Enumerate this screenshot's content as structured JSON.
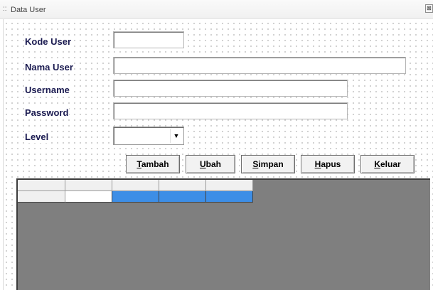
{
  "window": {
    "title": "Data User",
    "grip": "::",
    "close_symbol": "⊠"
  },
  "form": {
    "fields": [
      {
        "label": "Kode User",
        "value": ""
      },
      {
        "label": "Nama User",
        "value": ""
      },
      {
        "label": "Username",
        "value": ""
      },
      {
        "label": "Password",
        "value": ""
      }
    ],
    "level": {
      "label": "Level",
      "value": "",
      "arrow": "▼"
    }
  },
  "buttons": [
    {
      "mnemonic": "T",
      "rest": "ambah"
    },
    {
      "mnemonic": "U",
      "rest": "bah"
    },
    {
      "mnemonic": "S",
      "rest": "impan"
    },
    {
      "mnemonic": "H",
      "rest": "apus"
    },
    {
      "mnemonic": "K",
      "rest": "eluar"
    }
  ],
  "grid": {
    "columns": 5,
    "rows": 1,
    "selected_row": 0,
    "colors": {
      "background": "#7f7f7f",
      "selection": "#3d8ee6",
      "header": "#f0f0f0",
      "current_cell": "#ffffff"
    }
  }
}
